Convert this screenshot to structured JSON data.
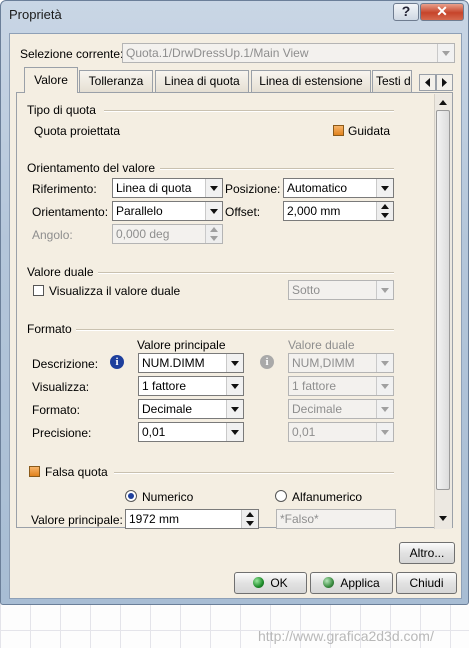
{
  "window": {
    "title": "Proprietà",
    "help_label": "?",
    "close_label": "✕"
  },
  "selection": {
    "label": "Selezione corrente:",
    "value": "Quota.1/DrwDressUp.1/Main View"
  },
  "tabs": [
    {
      "label": "Valore",
      "active": true
    },
    {
      "label": "Tolleranza"
    },
    {
      "label": "Linea di quota"
    },
    {
      "label": "Linea di estensione"
    },
    {
      "label": "Testi d"
    }
  ],
  "tipo_di_quota": {
    "title": "Tipo di quota",
    "type_label": "Quota proiettata",
    "guided_label": "Guidata"
  },
  "orientamento": {
    "title": "Orientamento del valore",
    "riferimento_label": "Riferimento:",
    "riferimento_value": "Linea di quota",
    "posizione_label": "Posizione:",
    "posizione_value": "Automatico",
    "orientamento_label": "Orientamento:",
    "orientamento_value": "Parallelo",
    "offset_label": "Offset:",
    "offset_value": "2,000 mm",
    "angolo_label": "Angolo:",
    "angolo_value": "0,000 deg"
  },
  "valore_duale": {
    "title": "Valore duale",
    "show_label": "Visualizza il valore duale",
    "position_value": "Sotto"
  },
  "formato": {
    "title": "Formato",
    "main_header": "Valore principale",
    "dual_header": "Valore duale",
    "rows": [
      {
        "label": "Descrizione:",
        "main": "NUM.DIMM",
        "dual": "NUM,DIMM"
      },
      {
        "label": "Visualizza:",
        "main": "1 fattore",
        "dual": "1 fattore"
      },
      {
        "label": "Formato:",
        "main": "Decimale",
        "dual": "Decimale"
      },
      {
        "label": "Precisione:",
        "main": "0,01",
        "dual": "0,01"
      }
    ],
    "info_icon": "i"
  },
  "falsa_quota": {
    "label": "Falsa quota",
    "numeric_label": "Numerico",
    "alpha_label": "Alfanumerico",
    "main_value_label": "Valore principale:",
    "main_value": "1972 mm",
    "alpha_value": "*Falso*"
  },
  "buttons": {
    "more": "Altro...",
    "ok": "OK",
    "apply": "Applica",
    "close": "Chiudi"
  },
  "watermark": "http://www.grafica2d3d.com/",
  "colors": {
    "accent_orange": "#e0821d",
    "info_blue": "#1e3f9c",
    "ok_green": "#1e8c2a",
    "close_red": "#c6442a"
  }
}
